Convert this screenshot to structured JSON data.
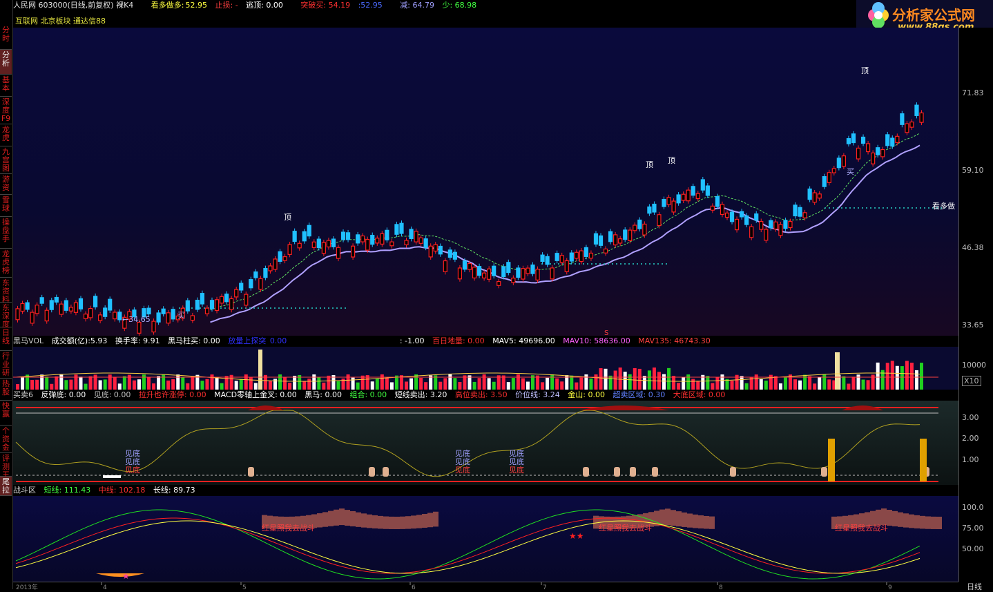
{
  "title_bar": {
    "stock": "人民网 603000(日线,前复权) 裸K4",
    "kdm_label": "看多做多:",
    "kdm_value": "52.95",
    "stoploss": "止损: -",
    "escape": "逃顶: 0.00",
    "breakout": "突破买: 54.19",
    "colon_val": ":52.95",
    "reduce": "减: 64.79",
    "less": "少: 68.98"
  },
  "subtitle": "互联网 北京板块 通达信88",
  "logo": {
    "name": "分析家公式网",
    "url": "www.88gs.com"
  },
  "sidebar": [
    {
      "label": "分时",
      "hl": false
    },
    {
      "label": "分析",
      "hl": true
    },
    {
      "label": "基本",
      "hl": false
    },
    {
      "label": "深度F9",
      "hl": false
    },
    {
      "label": "龙虎",
      "hl": false
    },
    {
      "label": "九宫图",
      "hl": false
    },
    {
      "label": "游资",
      "hl": false
    },
    {
      "label": "雪球",
      "hl": false
    },
    {
      "label": "操盘手",
      "hl": false
    },
    {
      "label": "龙虎榜",
      "hl": false
    },
    {
      "label": "东资料",
      "hl": false
    },
    {
      "label": "东深度",
      "hl": false
    },
    {
      "label": "日线",
      "hl": false
    },
    {
      "label": "行业研",
      "hl": false
    },
    {
      "label": "热股",
      "hl": false
    },
    {
      "label": "快赢",
      "hl": false
    },
    {
      "label": "个资金",
      "hl": false
    },
    {
      "label": "评测王",
      "hl": false
    },
    {
      "label": "尾拉",
      "hl": true
    }
  ],
  "main_chart": {
    "y_ticks": [
      "71.83",
      "59.10",
      "46.38",
      "33.65"
    ],
    "low_label": "←34.65",
    "buy_label": "买",
    "top_label": "顶",
    "look_long_label": "看多做",
    "marker_s": "S"
  },
  "vol_header": {
    "name": "黑马VOL",
    "amount": "成交额(亿):5.93",
    "turnover": "换手率: 9.91",
    "heima_buy": "黑马柱买: 0.00",
    "probe": "放量上探突",
    "probe_val": "0.00",
    "neg": ": -1.00",
    "bairi": "百日地量: 0.00",
    "mav5": "MAV5: 49696.00",
    "mav10": "MAV10: 58636.00",
    "mav135": "MAV135: 46743.30"
  },
  "vol_axis": {
    "tick": "10000",
    "unit": "X10"
  },
  "buy_header": {
    "name": "买卖6",
    "rebound": "反弹底: 0.00",
    "bottom": "见底: 0.00",
    "pullup": "拉升也许涨停: 0.00",
    "macd": "MACD零轴上金叉: 0.00",
    "heima": "黑马: 0.00",
    "combo": "组合: 0.00",
    "short_sell": "短线卖出: 3.20",
    "high_sell": "高位卖出: 3.50",
    "price_line": "价位线: 3.24",
    "golden": "金山: 0.00",
    "oversold": "超卖区域: 0.30",
    "bottom_zone": "大底区域: 0.00"
  },
  "buy_axis": [
    "3.00",
    "2.00",
    "1.00"
  ],
  "buy_labels": {
    "jiandi": "见底"
  },
  "battle_header": {
    "name": "战斗区",
    "short": "短线: 111.43",
    "mid": "中线: 102.18",
    "long": "长线: 89.73"
  },
  "battle_axis": [
    "100.0",
    "75.00",
    "50.00"
  ],
  "battle_label": "红星照我去战斗",
  "date_axis": {
    "year": "2013年",
    "months": [
      "4",
      "5",
      "6",
      "7",
      "8",
      "9"
    ],
    "period": "日线"
  },
  "colors": {
    "up": "#ff2020",
    "down": "#20c0ff",
    "ma": "#b0a0ff",
    "bg_top": "#0a0a30"
  }
}
